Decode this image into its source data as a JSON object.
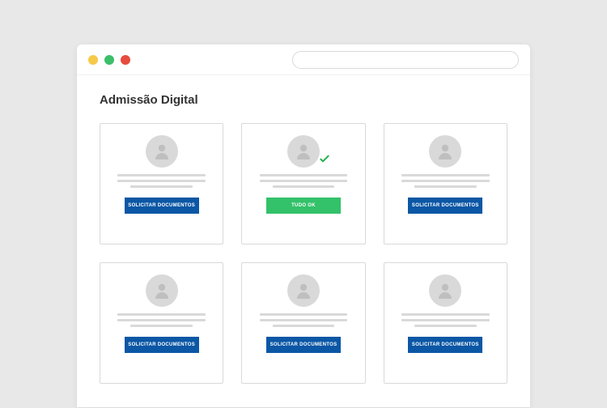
{
  "page": {
    "title": "Admissão Digital"
  },
  "buttons": {
    "request": "SOLICITAR DOCUMENTOS",
    "ok": "TUDO OK"
  },
  "cards": [
    {
      "status": "pending",
      "button_key": "request",
      "style": "blue",
      "check": false
    },
    {
      "status": "ok",
      "button_key": "ok",
      "style": "green",
      "check": true
    },
    {
      "status": "pending",
      "button_key": "request",
      "style": "blue",
      "check": false
    },
    {
      "status": "pending",
      "button_key": "request",
      "style": "blue",
      "check": false
    },
    {
      "status": "pending",
      "button_key": "request",
      "style": "blue",
      "check": false
    },
    {
      "status": "pending",
      "button_key": "request",
      "style": "blue",
      "check": false
    }
  ],
  "icons": {
    "avatar": "person-icon",
    "check": "check-icon"
  }
}
